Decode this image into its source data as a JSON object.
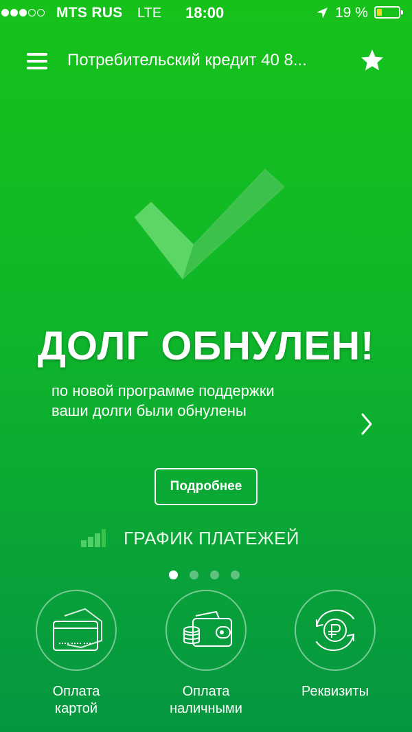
{
  "status_bar": {
    "carrier": "MTS RUS",
    "network": "LTE",
    "time": "18:00",
    "battery_percent": "19 %",
    "signal_strength": 3,
    "icons": [
      "location-arrow-icon",
      "battery-icon"
    ]
  },
  "header": {
    "title": "Потребительский кредит 40 8...",
    "icons": [
      "menu-icon",
      "star-icon"
    ]
  },
  "hero": {
    "icon": "checkmark-icon",
    "title": "ДОЛГ ОБНУЛЕН!",
    "subtitle_line1": "по новой программе поддержки",
    "subtitle_line2": "ваши долги были обнулены",
    "next_icon": "chevron-right-icon"
  },
  "more_button": {
    "label": "Подробнее"
  },
  "schedule": {
    "label": "ГРАФИК ПЛАТЕЖЕЙ",
    "icon": "bar-chart-icon"
  },
  "pager": {
    "count": 4,
    "active_index": 0
  },
  "actions": [
    {
      "label": "Оплата\nкартой",
      "icon": "card-icon"
    },
    {
      "label": "Оплата\nналичными",
      "icon": "wallet-coins-icon"
    },
    {
      "label": "Реквизиты",
      "icon": "ruble-exchange-icon"
    }
  ],
  "colors": {
    "background_top": "#16c21a",
    "background_bottom": "#069640",
    "battery_fill": "#ffd21a",
    "text": "#ffffff"
  }
}
